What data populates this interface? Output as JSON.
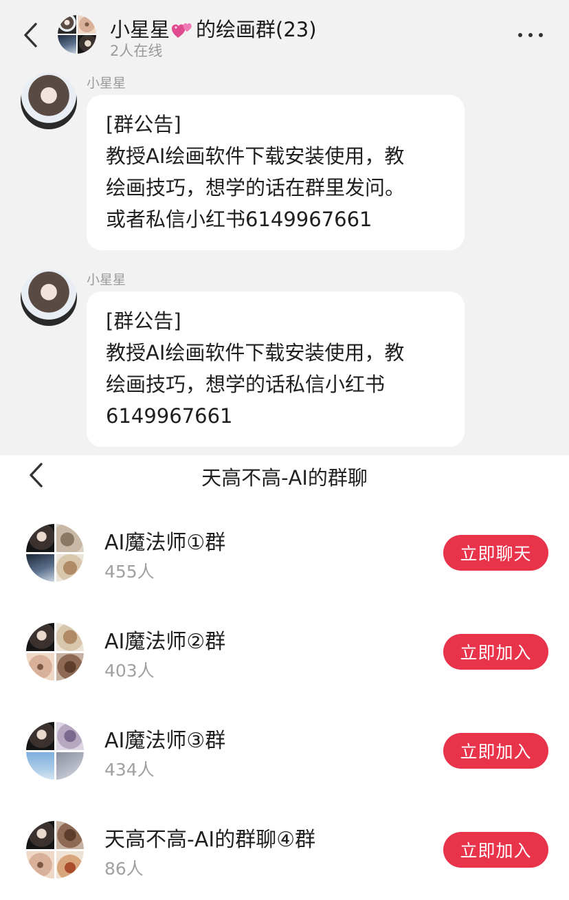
{
  "chat": {
    "title_before": "小星星",
    "title_after": "的绘画群(23)",
    "title_emoji": "heart-emoji",
    "subtitle": "2人在线",
    "messages": [
      {
        "sender": "小星星",
        "lines": [
          "[群公告]",
          "教授AI绘画软件下载安装使用，教",
          "绘画技巧，想学的话在群里发问。",
          "或者私信小红书6149967661"
        ]
      },
      {
        "sender": "小星星",
        "lines": [
          "[群公告]",
          "教授AI绘画软件下载安装使用，教",
          "绘画技巧，想学的话私信小红书",
          "6149967661"
        ]
      }
    ]
  },
  "group_list": {
    "title": "天高不高-AI的群聊",
    "groups": [
      {
        "name": "AI魔法师①群",
        "count": "455人",
        "button": "立即聊天"
      },
      {
        "name": "AI魔法师②群",
        "count": "403人",
        "button": "立即加入"
      },
      {
        "name": "AI魔法师③群",
        "count": "434人",
        "button": "立即加入"
      },
      {
        "name": "天高不高-AI的群聊④群",
        "count": "86人",
        "button": "立即加入"
      }
    ]
  },
  "colors": {
    "accent_button": "#e8334a",
    "chat_background": "#f2f2f2",
    "secondary_text": "#9a9a9a"
  },
  "icons": [
    "back-arrow-icon",
    "more-icon",
    "heart-emoji"
  ]
}
